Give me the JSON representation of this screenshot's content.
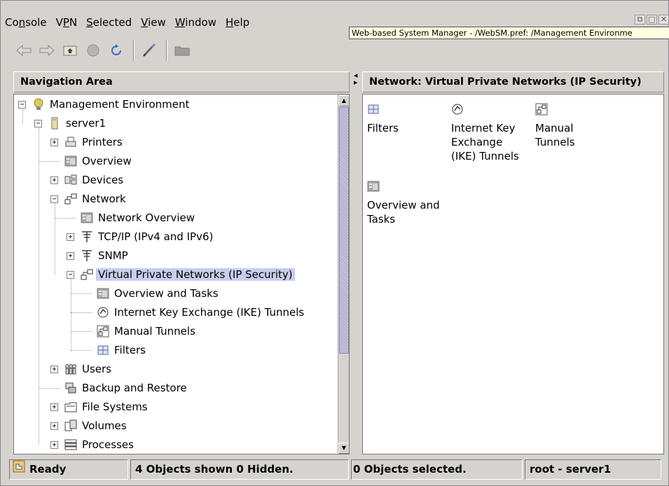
{
  "menubar": {
    "items": [
      {
        "pre": "Co",
        "u": "n",
        "post": "sole"
      },
      {
        "pre": "V",
        "u": "P",
        "post": "N"
      },
      {
        "pre": "",
        "u": "S",
        "post": "elected"
      },
      {
        "pre": "",
        "u": "V",
        "post": "iew"
      },
      {
        "pre": "",
        "u": "W",
        "post": "indow"
      },
      {
        "pre": "",
        "u": "H",
        "post": "elp"
      }
    ]
  },
  "tooltip": "Web-based System Manager - /WebSM.pref: /Management Environme",
  "toolbar": {
    "icons": [
      "back-arrow-icon",
      "forward-arrow-icon",
      "up-folder-icon",
      "stop-icon",
      "reload-icon",
      "find-icon",
      "folder-icon"
    ]
  },
  "navigation": {
    "title": "Navigation Area",
    "tree": [
      {
        "label": "Management Environment",
        "level": 0,
        "expander": "-",
        "icon": "globe-icon"
      },
      {
        "label": "server1",
        "level": 1,
        "expander": "-",
        "icon": "server-icon"
      },
      {
        "label": "Printers",
        "level": 2,
        "expander": "+",
        "icon": "printer-icon"
      },
      {
        "label": "Overview",
        "level": 2,
        "expander": "",
        "icon": "overview-icon"
      },
      {
        "label": "Devices",
        "level": 2,
        "expander": "+",
        "icon": "devices-icon"
      },
      {
        "label": "Network",
        "level": 2,
        "expander": "-",
        "icon": "network-icon"
      },
      {
        "label": "Network Overview",
        "level": 3,
        "expander": "",
        "icon": "overview-icon"
      },
      {
        "label": "TCP/IP (IPv4 and IPv6)",
        "level": 3,
        "expander": "+",
        "icon": "antenna-icon"
      },
      {
        "label": "SNMP",
        "level": 3,
        "expander": "+",
        "icon": "antenna-icon"
      },
      {
        "label": "Virtual Private Networks (IP Security)",
        "level": 3,
        "expander": "-",
        "icon": "network-icon",
        "selected": true
      },
      {
        "label": "Overview and Tasks",
        "level": 4,
        "expander": "",
        "icon": "overview-icon"
      },
      {
        "label": "Internet Key Exchange (IKE) Tunnels",
        "level": 4,
        "expander": "",
        "icon": "key-exchange-icon"
      },
      {
        "label": "Manual Tunnels",
        "level": 4,
        "expander": "",
        "icon": "tunnel-icon"
      },
      {
        "label": "Filters",
        "level": 4,
        "expander": "",
        "icon": "filter-icon"
      },
      {
        "label": "Users",
        "level": 2,
        "expander": "+",
        "icon": "users-icon"
      },
      {
        "label": "Backup and Restore",
        "level": 2,
        "expander": "",
        "icon": "backup-icon"
      },
      {
        "label": "File Systems",
        "level": 2,
        "expander": "+",
        "icon": "file-systems-icon"
      },
      {
        "label": "Volumes",
        "level": 2,
        "expander": "+",
        "icon": "volumes-icon"
      },
      {
        "label": "Processes",
        "level": 2,
        "expander": "+",
        "icon": "processes-icon"
      }
    ]
  },
  "content": {
    "title": "Network: Virtual Private Networks (IP Security)",
    "items": [
      {
        "lines": [
          "Filters"
        ],
        "icon": "filter-icon"
      },
      {
        "lines": [
          "Internet Key",
          "Exchange",
          "(IKE) Tunnels"
        ],
        "icon": "key-exchange-icon"
      },
      {
        "lines": [
          "Manual",
          "Tunnels"
        ],
        "icon": "tunnel-icon"
      },
      {
        "lines": [
          "Overview and",
          "Tasks"
        ],
        "icon": "overview-icon"
      }
    ]
  },
  "statusbar": {
    "ready": "Ready",
    "objects_shown": "4 Objects shown 0 Hidden.",
    "objects_selected": "0 Objects selected.",
    "user_host": "root - server1"
  }
}
